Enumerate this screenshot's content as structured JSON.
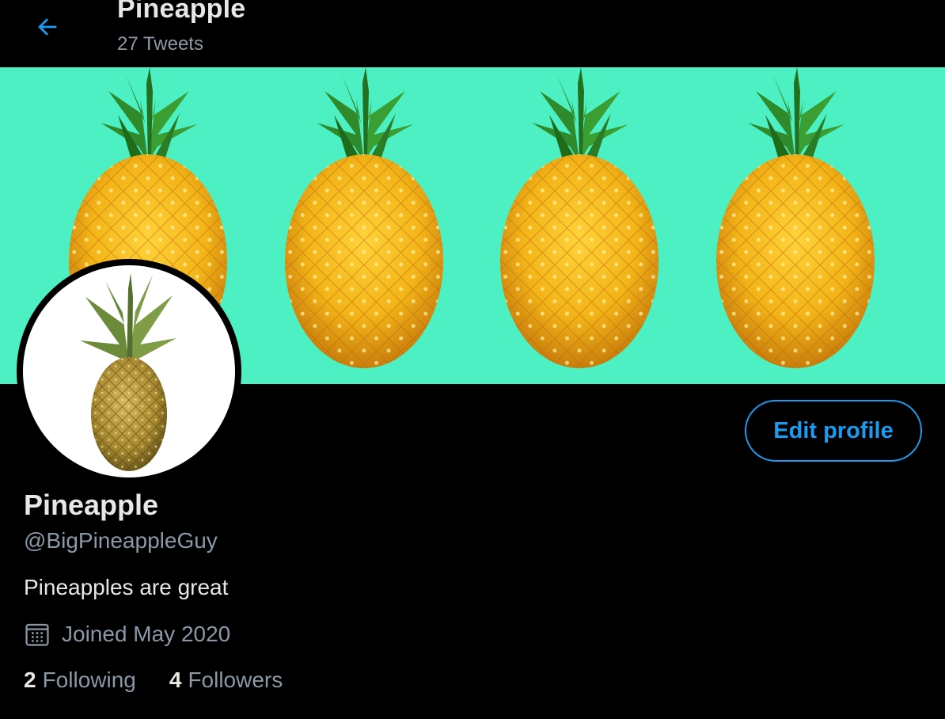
{
  "header": {
    "title": "Pineapple",
    "tweet_count": "27 Tweets"
  },
  "profile": {
    "display_name": "Pineapple",
    "handle": "@BigPineappleGuy",
    "bio": "Pineapples are great",
    "joined": "Joined May 2020",
    "following_count": "2",
    "following_label": "Following",
    "followers_count": "4",
    "followers_label": "Followers",
    "edit_label": "Edit profile"
  },
  "icons": {
    "back": "arrow-left-icon",
    "calendar": "calendar-icon"
  },
  "colors": {
    "accent": "#1d9bf0",
    "banner_bg": "#4df0c2",
    "background": "#000000",
    "muted_text": "#8b98a5"
  }
}
